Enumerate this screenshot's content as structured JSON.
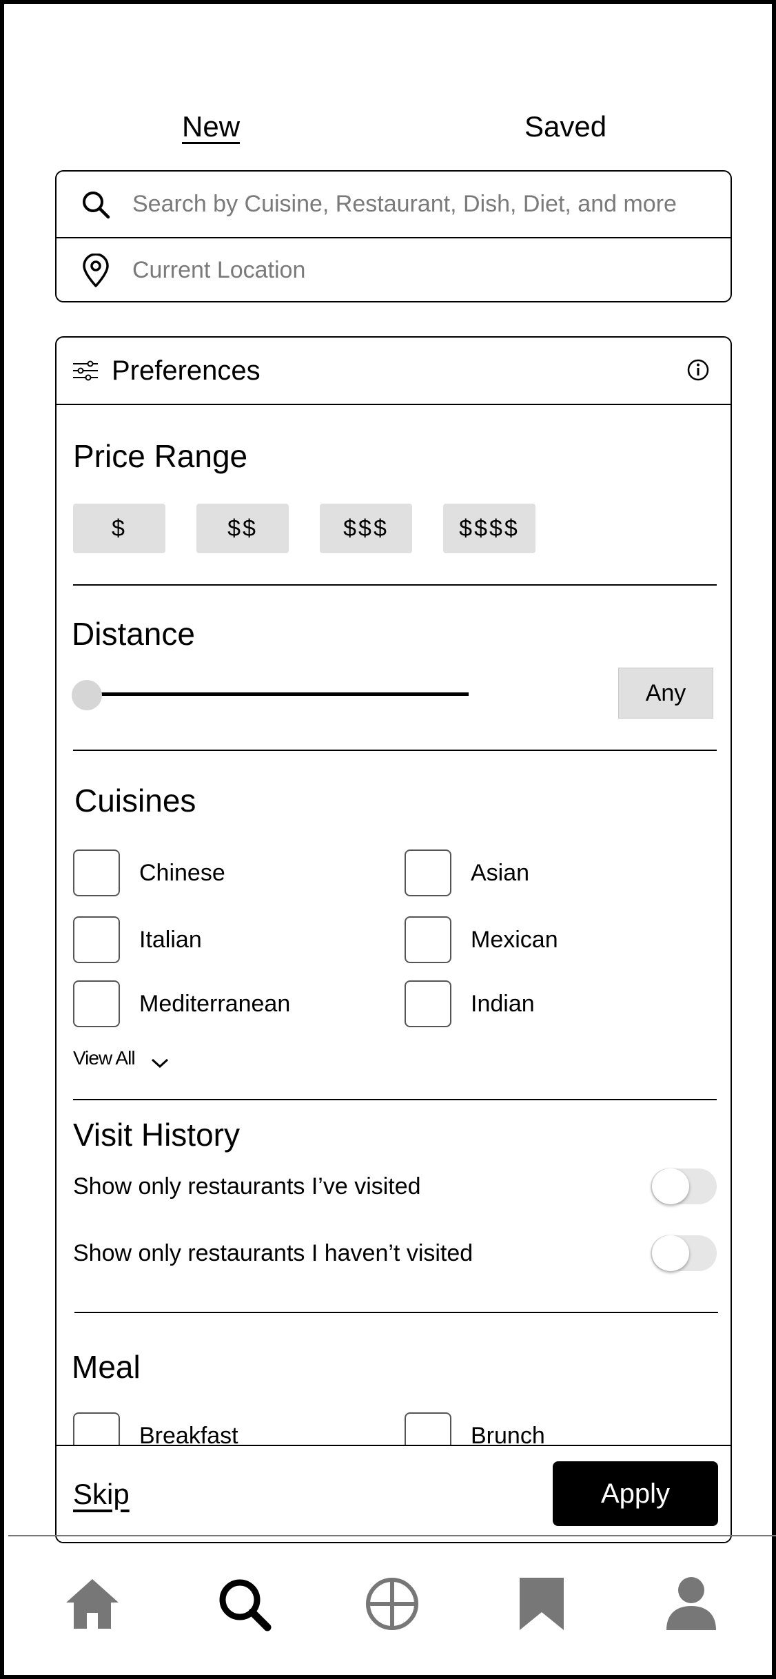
{
  "tabs": {
    "new_label": "New",
    "saved_label": "Saved"
  },
  "search": {
    "query_placeholder": "Search by Cuisine, Restaurant, Dish, Diet, and more",
    "location_placeholder": "Current Location"
  },
  "preferences": {
    "title": "Preferences",
    "icons": {
      "header": "sliders-icon",
      "info": "info-icon"
    },
    "price_range": {
      "title": "Price Range",
      "options": [
        "$",
        "$$",
        "$$$",
        "$$$$"
      ]
    },
    "distance": {
      "title": "Distance",
      "slider_value": 0,
      "any_label": "Any"
    },
    "cuisines": {
      "title": "Cuisines",
      "items": [
        "Chinese",
        "Asian",
        "Italian",
        "Mexican",
        "Mediterranean",
        "Indian"
      ],
      "view_all_label": "View All"
    },
    "visit_history": {
      "title": "Visit History",
      "option_visited": "Show only restaurants I’ve visited",
      "option_not_visited": "Show only restaurants I haven’t visited",
      "visited_on": false,
      "not_visited_on": false
    },
    "meal": {
      "title": "Meal",
      "items": [
        "Breakfast",
        "Brunch"
      ]
    },
    "footer": {
      "skip_label": "Skip",
      "apply_label": "Apply"
    }
  },
  "bottom_nav": {
    "items": [
      "home-icon",
      "search-icon",
      "compass-icon",
      "bookmark-icon",
      "profile-icon"
    ],
    "active": "search-icon"
  },
  "colors": {
    "button_bg": "#e0e0e0",
    "apply_bg": "#000000",
    "icon_grey": "#777777",
    "placeholder": "#7a7a7a"
  }
}
